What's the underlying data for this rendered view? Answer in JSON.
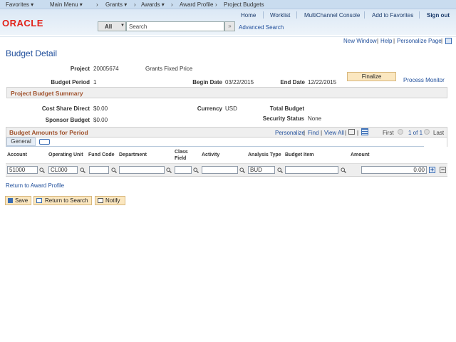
{
  "nav": {
    "favorites": "Favorites ▾",
    "main_menu": "Main Menu ▾",
    "crumbs": [
      "Grants ▾",
      "Awards ▾",
      "Award Profile",
      "Project Budgets"
    ]
  },
  "header": {
    "links": [
      "Home",
      "Worklist",
      "MultiChannel Console",
      "Add to Favorites"
    ],
    "signout": "Sign out",
    "logo": "ORACLE",
    "search_scope": "All",
    "search_placeholder": "Search",
    "advanced_search": "Advanced Search"
  },
  "utility": {
    "new_window": "New Window",
    "help": "Help",
    "personalize_page": "Personalize Page"
  },
  "page": {
    "title": "Budget Detail",
    "project_label": "Project",
    "project": "20005674",
    "project_desc": "Grants Fixed Price",
    "budget_period_label": "Budget Period",
    "budget_period": "1",
    "begin_date_label": "Begin Date",
    "begin_date": "03/22/2015",
    "end_date_label": "End Date",
    "end_date": "12/22/2015",
    "finalize": "Finalize",
    "process_monitor": "Process Monitor",
    "summary_title": "Project Budget Summary",
    "cost_share_label": "Cost Share Direct",
    "cost_share": "$0.00",
    "currency_label": "Currency",
    "currency": "USD",
    "total_budget_label": "Total Budget",
    "sponsor_budget_label": "Sponsor Budget",
    "sponsor_budget": "$0.00",
    "security_status_label": "Security Status",
    "security_status": "None"
  },
  "grid": {
    "title": "Budget Amounts for Period",
    "personalize": "Personalize",
    "find": "Find",
    "view_all": "View All",
    "first": "First",
    "page_info": "1 of 1",
    "last": "Last",
    "tab": "General",
    "columns": [
      "Account",
      "Operating Unit",
      "Fund Code",
      "Department",
      "Class Field",
      "Activity",
      "Analysis Type",
      "Budget Item",
      "Amount"
    ],
    "row": {
      "account": "51000",
      "operating_unit": "CL000",
      "fund_code": "",
      "department": "",
      "class_field": "",
      "activity": "",
      "analysis_type": "BUD",
      "budget_item": "",
      "amount": "0.00"
    }
  },
  "return_link": "Return to Award Profile",
  "buttons": {
    "save": "Save",
    "return_to_search": "Return to Search",
    "notify": "Notify"
  }
}
